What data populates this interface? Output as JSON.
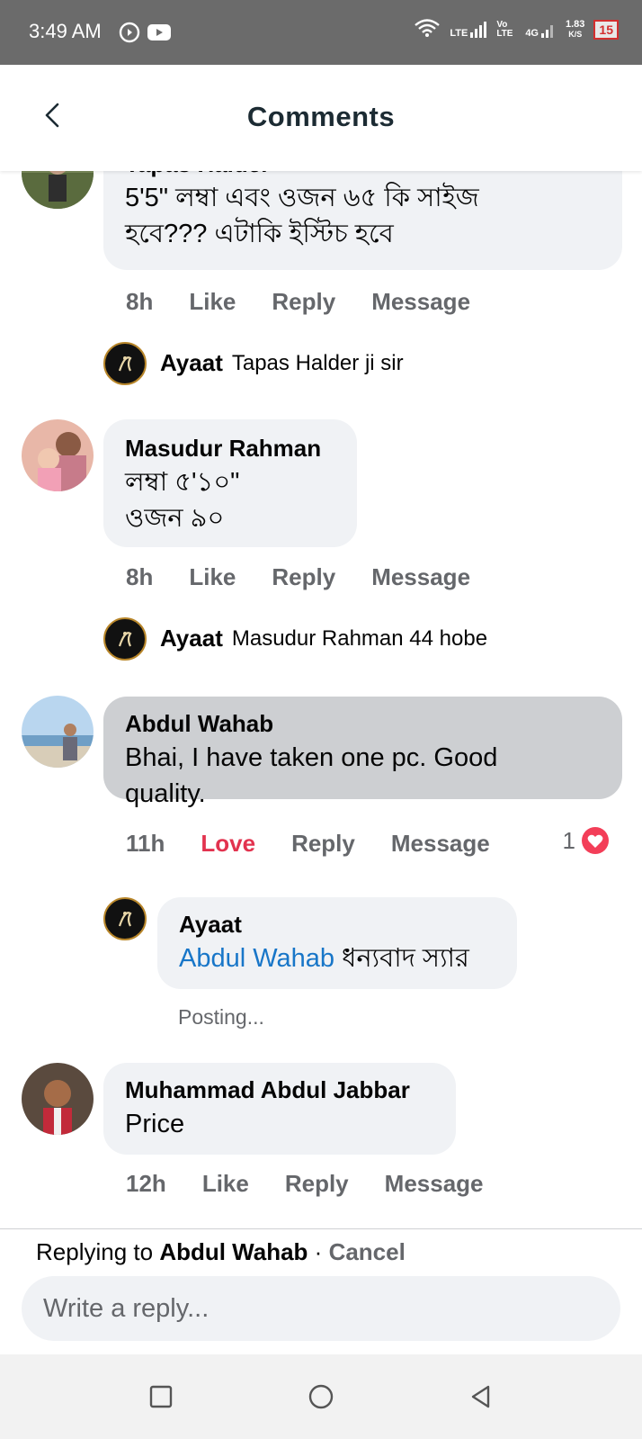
{
  "status": {
    "time": "3:49 AM",
    "network1": "LTE",
    "volte": "Vo LTE",
    "network2": "4G",
    "speed": "1.83",
    "speed_unit": "K/S",
    "battery": "15"
  },
  "header": {
    "title": "Comments"
  },
  "comments": [
    {
      "name": "Tapas Halder",
      "text_lines": [
        "5'5\" লম্বা এবং ওজন ৬৫ কি সাইজ",
        "হবে??? এটাকি ইস্টিচ হবে"
      ],
      "time": "8h",
      "like": "Like",
      "reply": "Reply",
      "message": "Message",
      "reply_item": {
        "name": "Ayaat",
        "text": "Tapas Halder ji sir"
      }
    },
    {
      "name": "Masudur Rahman",
      "text_lines": [
        "লম্বা ৫'১০\"",
        "ওজন ৯০"
      ],
      "time": "8h",
      "like": "Like",
      "reply": "Reply",
      "message": "Message",
      "reply_item": {
        "name": "Ayaat",
        "text": "Masudur Rahman 44 hobe"
      }
    },
    {
      "name": "Abdul Wahab",
      "text_lines": [
        "Bhai, I have taken one pc. Good",
        "quality."
      ],
      "time": "11h",
      "like": "Love",
      "reply": "Reply",
      "message": "Message",
      "reaction_count": "1",
      "pending_reply": {
        "name": "Ayaat",
        "mention": "Abdul Wahab",
        "text": " ধন্যবাদ স্যার",
        "status": "Posting..."
      }
    },
    {
      "name": "Muhammad Abdul Jabbar",
      "text_lines": [
        "Price"
      ],
      "time": "12h",
      "like": "Like",
      "reply": "Reply",
      "message": "Message"
    }
  ],
  "composer": {
    "replying_prefix": "Replying to ",
    "replying_name": "Abdul Wahab",
    "separator": " · ",
    "cancel": "Cancel",
    "placeholder": "Write a reply..."
  },
  "colors": {
    "love": "#e2334f",
    "mention": "#1876c8",
    "bubble": "#f0f2f5",
    "selected_bubble": "#cdcfd2"
  }
}
